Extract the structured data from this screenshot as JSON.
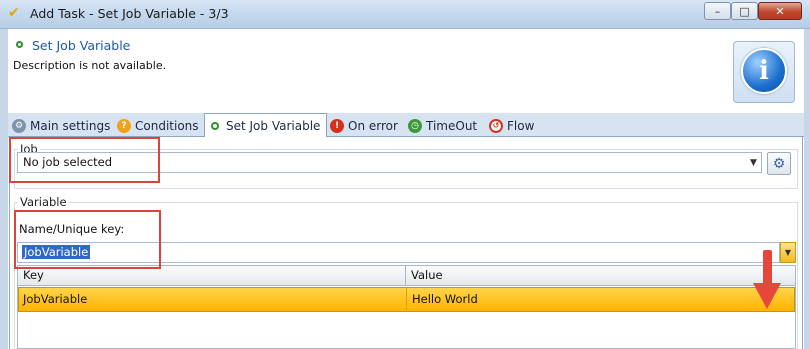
{
  "window": {
    "title": "Add Task - Set Job Variable - 3/3",
    "minimize_glyph": "–",
    "maximize_glyph": "□",
    "close_glyph": "✕"
  },
  "header": {
    "title": "Set Job Variable",
    "description": "Description is not available.",
    "info_glyph": "i"
  },
  "tabs": [
    {
      "label": "Main settings",
      "icon": "gears-icon",
      "color": "#6b7f99"
    },
    {
      "label": "Conditions",
      "icon": "question-icon",
      "color": "#f0a21a"
    },
    {
      "label": "Set Job Variable",
      "icon": "green-dot-icon",
      "color": "#2f8f2f",
      "active": true
    },
    {
      "label": "On error",
      "icon": "error-icon",
      "color": "#d6301f"
    },
    {
      "label": "TimeOut",
      "icon": "timeout-icon",
      "color": "#3a9a3a"
    },
    {
      "label": "Flow",
      "icon": "flow-icon",
      "color": "#d6301f"
    }
  ],
  "job": {
    "legend": "Job",
    "selected": "No job selected"
  },
  "variable": {
    "legend": "Variable",
    "key_label": "Name/Unique key:",
    "key_value": "JobVariable"
  },
  "grid": {
    "columns": [
      "Key",
      "Value"
    ],
    "rows": [
      {
        "key": "JobVariable",
        "value": "Hello World"
      }
    ]
  },
  "colors": {
    "selected_row": "#ffc107",
    "annotation": "#d9443c",
    "accent_blue": "#1c57b4"
  }
}
